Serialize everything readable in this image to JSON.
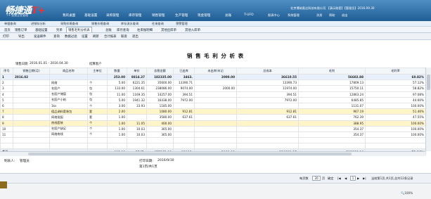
{
  "brand": {
    "logo_text": "畅捷通",
    "logo_plus": "T+",
    "logo_sub": "T+ 智慧企业管理"
  },
  "main_nav": [
    "我的桌面",
    "基础设置",
    "采购管理",
    "库存管理",
    "销售管理",
    "生产管理",
    "现金管理",
    "总账",
    "T-UFO",
    "报表中心",
    "系统管理"
  ],
  "company": "北京博纳奥达科技有限公司 【演示账套】【管理员】2016.09.30",
  "user_links": [
    "消息",
    "帮助",
    "退出"
  ],
  "secondary_nav": [
    "单据查询",
    "进销存分析",
    "采购价格查询",
    "销售价格查询",
    "库存流水查询",
    "往来查询",
    "预警管理"
  ],
  "tabs": [
    "首页",
    "销售订单",
    "基础设置",
    "凭单",
    "销售毛利分析表",
    "总账",
    "库存查询",
    "往来账明细",
    "其他出库单",
    "其他入库单"
  ],
  "active_tab": 4,
  "toolbar": [
    "打印",
    "导出",
    "发送邮件",
    "查询",
    "数据过滤",
    "设置",
    "刷新",
    "合计报表",
    "联查",
    "退出"
  ],
  "report": {
    "title": "销 售 毛 利 分 析 表",
    "date_label": "销售日期",
    "date_range": "2016.01.01 - 2016.04.30",
    "group_label": "结算客户"
  },
  "columns": [
    "序号",
    "销售日期(月)",
    "商品名称",
    "主单位",
    "数量",
    "单价",
    "含税金额",
    "已出库",
    "未出库/未记",
    "总成本",
    "毛利",
    "毛利率"
  ],
  "rows": [
    {
      "cls": "sum",
      "c": [
        "1",
        "2016.02",
        "",
        "",
        "253.00",
        "8814.37",
        "182335.00",
        "3463.",
        "2000.00",
        "36610.55",
        "56602.88",
        "60.82%"
      ]
    },
    {
      "cls": "",
      "c": [
        "2",
        "",
        "网络",
        "个",
        "5.00",
        "6221.35",
        "35600.00",
        "13390.71",
        "",
        "13390.73",
        "17809.13",
        "57.12%"
      ]
    },
    {
      "cls": "",
      "c": [
        "3",
        "",
        "名医产",
        "包",
        "133.00",
        "1304.61",
        "238086.00",
        "9074.00",
        "2000.00",
        "11974.00",
        "15750.11",
        "58.82%"
      ]
    },
    {
      "cls": "",
      "c": [
        "4",
        "",
        "名医产储值",
        "包",
        "11.00",
        "1169.35",
        "14257.00",
        "394.51",
        "",
        "394.51",
        "12863.24",
        "97.08%"
      ]
    },
    {
      "cls": "",
      "c": [
        "5",
        "",
        "名医产小结",
        "包",
        "5.00",
        "1941.32",
        "16438.00",
        "7972.00",
        "",
        "7972.00",
        "6485.85",
        "44.60%"
      ]
    },
    {
      "cls": "",
      "c": [
        "6",
        "",
        "1ks",
        "个",
        "3.00",
        "33.93",
        "1185.00",
        "",
        "",
        "",
        "1131.07",
        "100.00%"
      ]
    },
    {
      "cls": "hl",
      "c": [
        "7",
        "",
        "德品调料套装包",
        "套",
        "2.00",
        "",
        "1080.00",
        "912.81",
        "",
        "912.81",
        "967.19",
        "51.46%"
      ]
    },
    {
      "cls": "",
      "c": [
        "8",
        "",
        "网络批配",
        "套",
        "1.00",
        "",
        "3580.00",
        "637.61",
        "",
        "637.61",
        "762.39",
        "47.55%"
      ]
    },
    {
      "cls": "hl",
      "c": [
        "9",
        "",
        "热线套装",
        "个",
        "1.00",
        "11.05",
        "400.00",
        "",
        "",
        "",
        "388.95",
        "100.00%"
      ]
    },
    {
      "cls": "",
      "c": [
        "10",
        "",
        "名医产缺足",
        "个",
        "1.00",
        "10.03",
        "365.00",
        "",
        "",
        "",
        "354.37",
        "100.00%"
      ]
    },
    {
      "cls": "",
      "c": [
        "11",
        "",
        "网络南线",
        "个",
        "1.00",
        "10.03",
        "365.00",
        "",
        "",
        "",
        "354.37",
        "100.00%"
      ]
    },
    {
      "cls": "",
      "c": [
        "",
        "",
        "",
        "",
        "",
        "",
        "",
        "",
        "",
        "",
        "",
        ""
      ]
    },
    {
      "cls": "",
      "c": [
        "",
        "",
        "",
        "",
        "",
        "",
        "",
        "",
        "",
        "",
        "",
        ""
      ]
    }
  ],
  "total": {
    "label": "合计",
    "c": [
      "446.00",
      "3547.",
      "455263.00",
      "11986.",
      "2000.00",
      "120891.15",
      "298086.04",
      "71.26%"
    ]
  },
  "footer": {
    "maker_label": "制表人:",
    "maker": "管理员",
    "print_date_label": "打印日期:",
    "print_date": "2016/9/30",
    "page_info": "第1页/共1页"
  },
  "pager": {
    "per_page_label": "每页数",
    "per_page": "20",
    "page_label": "页",
    "goto_label": "确定",
    "current": "1",
    "summary": "当前第1页,共1页,总共12条记录"
  },
  "zoom": "100%",
  "colors": {
    "header_top": "#4f8fc4",
    "header_bottom": "#1f5d94",
    "sum_row": "#e8f1fb",
    "highlight_row": "#fff5c8",
    "gold_tab": "#8c6b1e"
  }
}
